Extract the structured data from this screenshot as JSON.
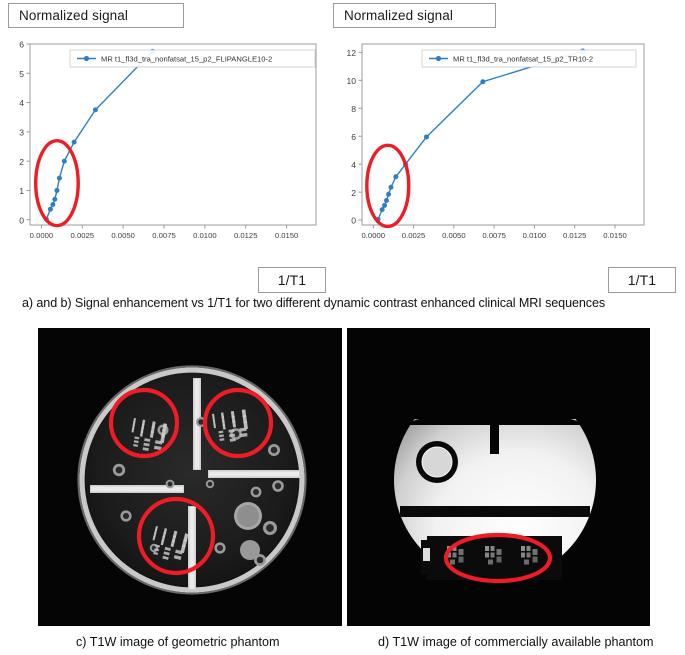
{
  "figure": {
    "panel_a": {
      "ylabel": "Normalized signal",
      "xlabel": "1/T1"
    },
    "panel_b": {
      "ylabel": "Normalized signal",
      "xlabel": "1/T1"
    },
    "caption_ab": "a) and b) Signal enhancement vs 1/T1 for two different dynamic contrast enhanced clinical MRI sequences",
    "caption_c": "c)  T1W image of geometric phantom",
    "caption_d": "d)  T1W image of commercially available phantom"
  },
  "colors": {
    "series": "#2e7fc1",
    "annotation": "#ee1c25",
    "axis": "#9b9b9b",
    "tick_text": "#404040",
    "panel_border": "#9b9b9b"
  },
  "chart_data": [
    {
      "id": "panel-a",
      "type": "line",
      "title": "",
      "xlabel": "1/T1",
      "ylabel": "Normalized signal",
      "legend": [
        "MR t1_fl3d_tra_nonfatsat_15_p2_FLIPANGLE10-2"
      ],
      "legend_position": "upper center",
      "grid": false,
      "xlim": [
        -0.0007,
        0.0168
      ],
      "ylim": [
        -0.18,
        6.0
      ],
      "xticks": [
        0.0,
        0.0025,
        0.005,
        0.0075,
        0.01,
        0.0125,
        0.015
      ],
      "xticklabels": [
        "0.0000",
        "0.0025",
        "0.0050",
        "0.0075",
        "0.0100",
        "0.0125",
        "0.0150"
      ],
      "yticks": [
        0,
        1,
        2,
        3,
        4,
        5,
        6
      ],
      "yticklabels": [
        "0",
        "1",
        "2",
        "3",
        "4",
        "5",
        "6"
      ],
      "series": [
        {
          "name": "MR t1_fl3d_tra_nonfatsat_15_p2_FLIPANGLE10-2",
          "color": "#2e7fc1",
          "marker": "o",
          "x": [
            0.0003,
            0.00055,
            0.0007,
            0.00082,
            0.00095,
            0.0011,
            0.0014,
            0.002,
            0.0033,
            0.0068
          ],
          "y": [
            0.02,
            0.36,
            0.52,
            0.7,
            1.0,
            1.42,
            2.0,
            2.65,
            3.75,
            5.75
          ]
        }
      ],
      "annotations": [
        {
          "type": "ellipse",
          "name": "low-1/T1-region-highlight",
          "color": "#ee1c25",
          "center_x": 0.00095,
          "center_y": 1.25,
          "width_x": 0.0026,
          "height_y": 2.9
        }
      ]
    },
    {
      "id": "panel-b",
      "type": "line",
      "title": "",
      "xlabel": "1/T1",
      "ylabel": "Normalized signal",
      "legend": [
        "MR t1_fl3d_tra_nonfatsat_15_p2_TR10-2"
      ],
      "legend_position": "upper center",
      "grid": false,
      "xlim": [
        -0.0007,
        0.0168
      ],
      "ylim": [
        -0.35,
        12.6
      ],
      "xticks": [
        0.0,
        0.0025,
        0.005,
        0.0075,
        0.01,
        0.0125,
        0.015
      ],
      "xticklabels": [
        "0.0000",
        "0.0025",
        "0.0050",
        "0.0075",
        "0.0100",
        "0.0125",
        "0.0150"
      ],
      "yticks": [
        0,
        2,
        4,
        6,
        8,
        10,
        12
      ],
      "yticklabels": [
        "0",
        "2",
        "4",
        "6",
        "8",
        "10",
        "12"
      ],
      "series": [
        {
          "name": "MR t1_fl3d_tra_nonfatsat_15_p2_TR10-2",
          "color": "#2e7fc1",
          "marker": "o",
          "x": [
            0.0003,
            0.00055,
            0.0007,
            0.00082,
            0.00095,
            0.0011,
            0.0014,
            0.002,
            0.0033,
            0.0068,
            0.013
          ],
          "y": [
            0.05,
            0.75,
            1.05,
            1.4,
            1.85,
            2.35,
            3.1,
            4.0,
            5.95,
            9.9,
            12.1
          ]
        }
      ],
      "annotations": [
        {
          "type": "ellipse",
          "name": "low-1/T1-region-highlight",
          "color": "#ee1c25",
          "center_x": 0.0009,
          "center_y": 2.45,
          "width_x": 0.0026,
          "height_y": 5.8
        }
      ]
    }
  ],
  "mri_images": [
    {
      "id": "panel-c",
      "name": "geometric-phantom-t1w-image",
      "description": "T1W image of geometric phantom",
      "highlight_color": "#ee1c25",
      "highlight_count": 3,
      "highlight_shape": "circle"
    },
    {
      "id": "panel-d",
      "name": "commercial-phantom-t1w-image",
      "description": "T1W image of commercially available phantom",
      "highlight_color": "#ee1c25",
      "highlight_count": 1,
      "highlight_shape": "ellipse"
    }
  ]
}
